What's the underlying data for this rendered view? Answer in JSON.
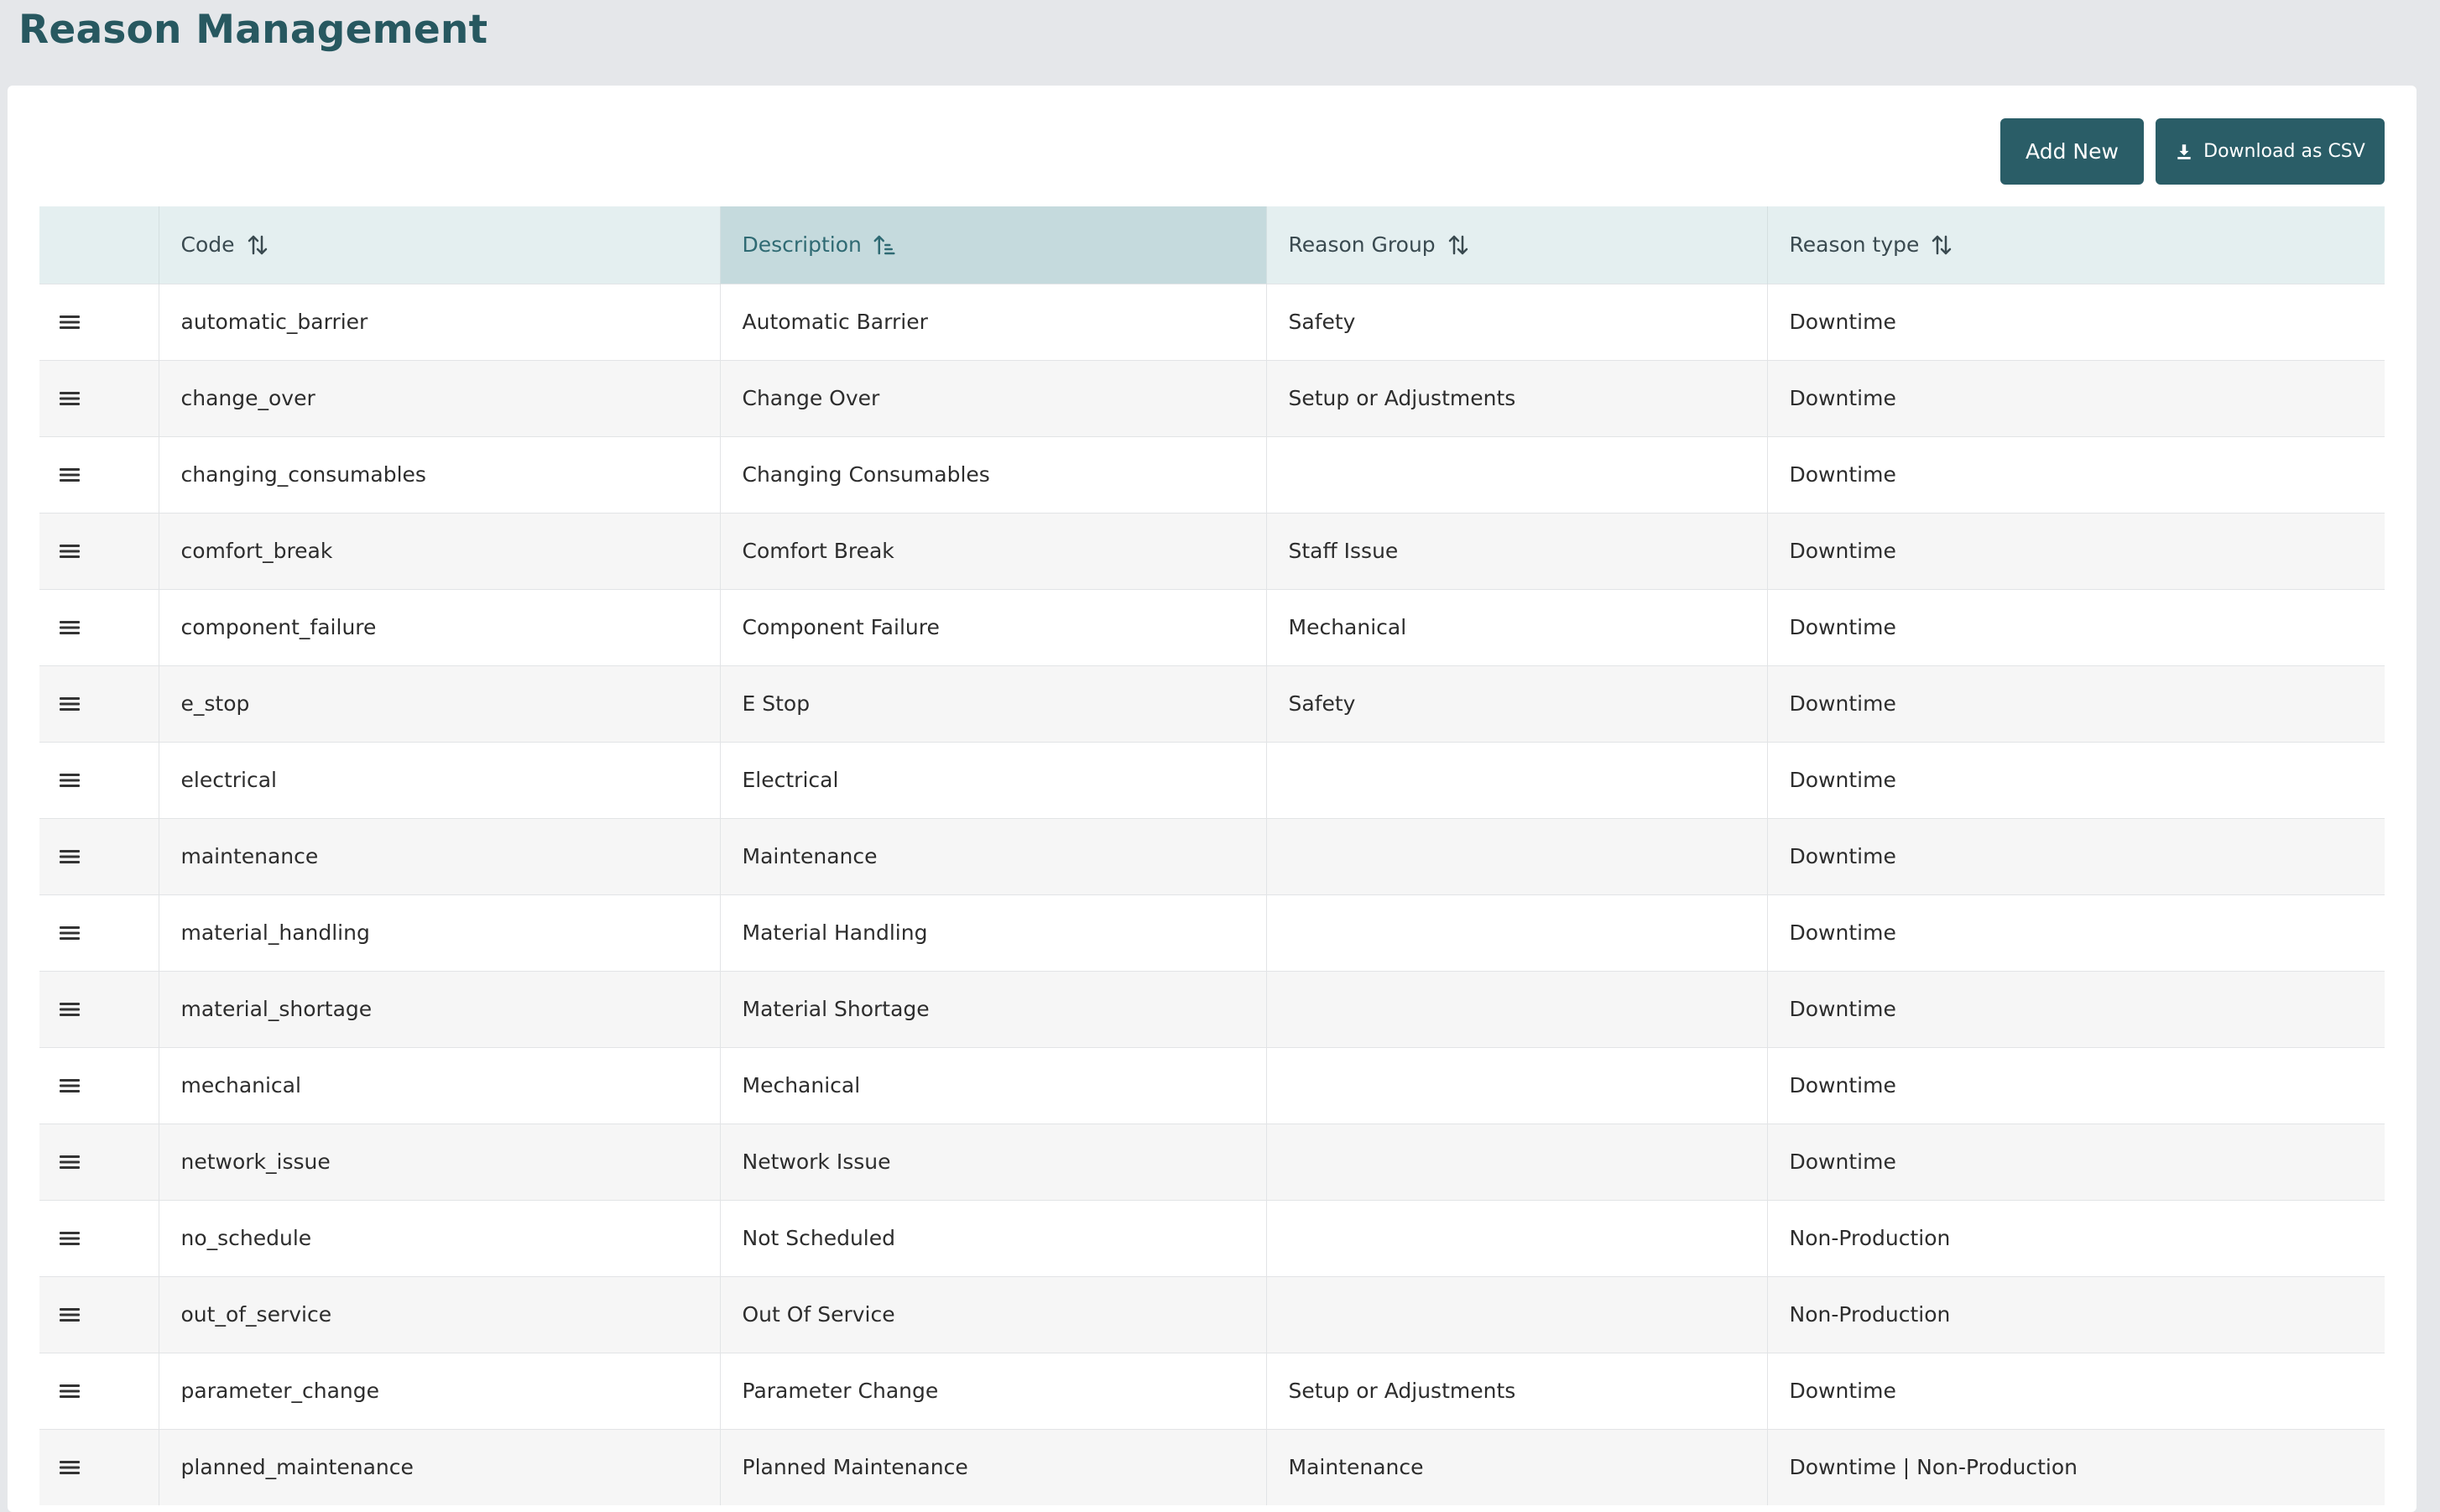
{
  "page": {
    "title": "Reason Management"
  },
  "toolbar": {
    "add_new_label": "Add New",
    "download_csv_label": "Download as CSV"
  },
  "table": {
    "columns": [
      "Code",
      "Description",
      "Reason Group",
      "Reason type"
    ],
    "sorted_column": "Description",
    "rows": [
      {
        "code": "automatic_barrier",
        "description": "Automatic Barrier",
        "group": "Safety",
        "type": "Downtime"
      },
      {
        "code": "change_over",
        "description": "Change Over",
        "group": "Setup or Adjustments",
        "type": "Downtime"
      },
      {
        "code": "changing_consumables",
        "description": "Changing Consumables",
        "group": "",
        "type": "Downtime"
      },
      {
        "code": "comfort_break",
        "description": "Comfort Break",
        "group": "Staff Issue",
        "type": "Downtime"
      },
      {
        "code": "component_failure",
        "description": "Component Failure",
        "group": "Mechanical",
        "type": "Downtime"
      },
      {
        "code": "e_stop",
        "description": "E Stop",
        "group": "Safety",
        "type": "Downtime"
      },
      {
        "code": "electrical",
        "description": "Electrical",
        "group": "",
        "type": "Downtime"
      },
      {
        "code": "maintenance",
        "description": "Maintenance",
        "group": "",
        "type": "Downtime"
      },
      {
        "code": "material_handling",
        "description": "Material Handling",
        "group": "",
        "type": "Downtime"
      },
      {
        "code": "material_shortage",
        "description": "Material Shortage",
        "group": "",
        "type": "Downtime"
      },
      {
        "code": "mechanical",
        "description": "Mechanical",
        "group": "",
        "type": "Downtime"
      },
      {
        "code": "network_issue",
        "description": "Network Issue",
        "group": "",
        "type": "Downtime"
      },
      {
        "code": "no_schedule",
        "description": "Not Scheduled",
        "group": "",
        "type": "Non-Production"
      },
      {
        "code": "out_of_service",
        "description": "Out Of Service",
        "group": "",
        "type": "Non-Production"
      },
      {
        "code": "parameter_change",
        "description": "Parameter Change",
        "group": "Setup or Adjustments",
        "type": "Downtime"
      },
      {
        "code": "planned_maintenance",
        "description": "Planned Maintenance",
        "group": "Maintenance",
        "type": "Downtime | Non-Production"
      }
    ]
  },
  "icons": {
    "drag_handle": "drag-handle-icon",
    "sort": "sort-icon",
    "sort_asc": "sort-ascending-icon",
    "download": "download-icon"
  },
  "colors": {
    "brand": "#2a5d67",
    "title": "#275860",
    "header_bg": "#e4eff0",
    "sorted_header_bg": "#c5dadd"
  }
}
